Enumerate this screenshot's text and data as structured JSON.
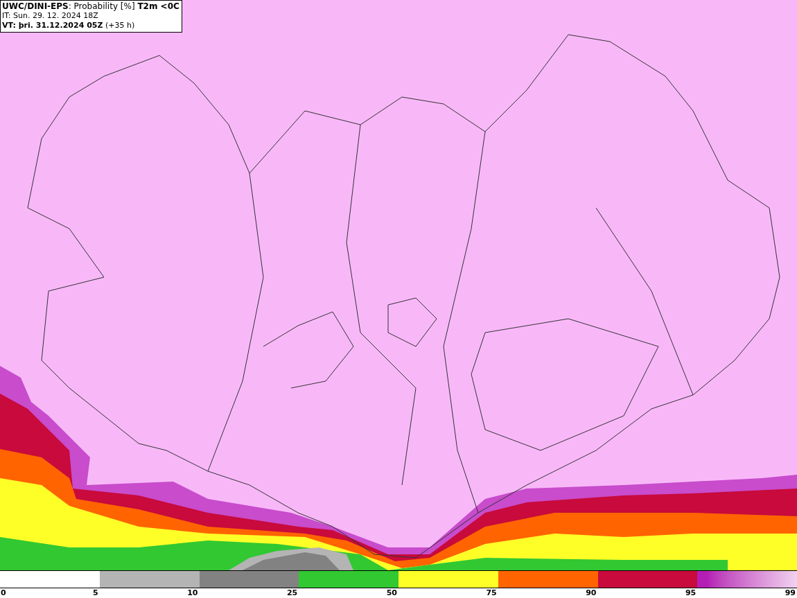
{
  "header": {
    "lines": [
      "**UWC/DINI-EPS**: Probability [%] **T2m <0C**",
      "IT: Sun. 29. 12. 2024 18Z",
      "**VT: þri. 31.12.2024 05Z** (+35 h)"
    ]
  },
  "legend": {
    "min_label": "0",
    "bins": [
      {
        "label": "5",
        "kind": "blank"
      },
      {
        "label": "10",
        "kind": "solid",
        "color": "#b4b4b4"
      },
      {
        "label": "25",
        "kind": "solid",
        "color": "#828282"
      },
      {
        "label": "50",
        "kind": "solid",
        "color": "#32c832"
      },
      {
        "label": "75",
        "kind": "solid",
        "color": "#ffff28"
      },
      {
        "label": "90",
        "kind": "solid",
        "color": "#ff6400"
      },
      {
        "label": "95",
        "kind": "solid",
        "color": "#c80a3c"
      },
      {
        "label": "99",
        "kind": "gradient",
        "color": "#b41eb4"
      }
    ]
  }
}
